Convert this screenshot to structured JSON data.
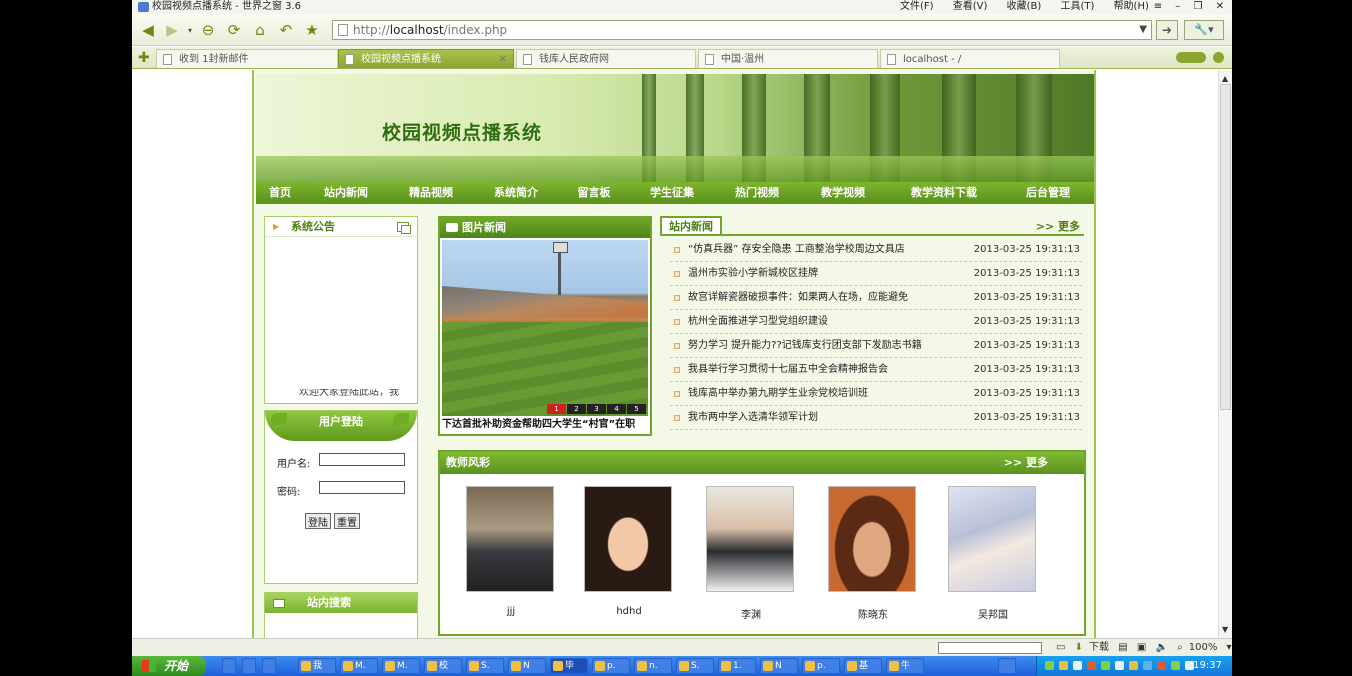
{
  "browser": {
    "title": "校园视频点播系统 - 世界之窗 3.6",
    "menu": [
      "文件(F)",
      "查看(V)",
      "收藏(B)",
      "工具(T)",
      "帮助(H)"
    ],
    "address_prefix": "http://",
    "address_host": "localhost",
    "address_path": "/index.php",
    "tabs": [
      {
        "label": "收到 1封新邮件",
        "active": false
      },
      {
        "label": "校园视频点播系统",
        "active": true
      },
      {
        "label": "钱库人民政府网",
        "active": false
      },
      {
        "label": "中国·温州",
        "active": false
      },
      {
        "label": "localhost - /",
        "active": false
      }
    ]
  },
  "site": {
    "banner_title": "校园视频点播系统",
    "nav": [
      "首页",
      "站内新闻",
      "精品视频",
      "系统简介",
      "留言板",
      "学生征集",
      "热门视频",
      "教学视频",
      "教学资料下载",
      "后台管理"
    ],
    "notice": {
      "title": "系统公告",
      "marquee": "欢迎大家登陆此站，我"
    },
    "login": {
      "title": "用户登陆",
      "username_label": "用户名:",
      "password_label": "密码:",
      "login_button": "登陆",
      "reset_button": "重置"
    },
    "search": {
      "title": "站内搜索"
    },
    "photo_news": {
      "title": "图片新闻",
      "pages": [
        "1",
        "2",
        "3",
        "4",
        "5"
      ],
      "active_page": "1",
      "caption": "下达首批补助资金帮助四大学生“村官”在职"
    },
    "news": {
      "title": "站内新闻",
      "more": ">> 更多",
      "items": [
        {
          "title": "“仿真兵器” 存安全隐患 工商整治学校周边文具店",
          "date": "2013-03-25 19:31:13"
        },
        {
          "title": "温州市实验小学新城校区挂牌",
          "date": "2013-03-25 19:31:13"
        },
        {
          "title": "故宫详解瓷器破损事件：如果两人在场，应能避免",
          "date": "2013-03-25 19:31:13"
        },
        {
          "title": "杭州全面推进学习型党组织建设",
          "date": "2013-03-25 19:31:13"
        },
        {
          "title": "努力学习 提升能力??记钱库支行团支部下发励志书籍",
          "date": "2013-03-25 19:31:13"
        },
        {
          "title": "我县举行学习贯彻十七届五中全会精神报告会",
          "date": "2013-03-25 19:31:13"
        },
        {
          "title": "钱库高中举办第九期学生业余党校培训班",
          "date": "2013-03-25 19:31:13"
        },
        {
          "title": "我市两中学入选清华领军计划",
          "date": "2013-03-25 19:31:13"
        }
      ]
    },
    "teachers": {
      "title": "教师风彩",
      "more": ">> 更多",
      "items": [
        {
          "name": "jjj"
        },
        {
          "name": "hdhd"
        },
        {
          "name": "李渊"
        },
        {
          "name": "陈晓东"
        },
        {
          "name": "吴邦国"
        }
      ]
    }
  },
  "statusbar": {
    "download": "下载",
    "zoom": "100%"
  },
  "taskbar": {
    "start": "开始",
    "items": [
      "我",
      "M.",
      "M.",
      "校",
      "S.",
      "N",
      "毕",
      "p.",
      "n.",
      "S.",
      "1.",
      "N",
      "p.",
      "基",
      "牛"
    ],
    "clock": "19:37"
  },
  "colors": {
    "nav_green": "#58901a",
    "panel_border": "#a9cf6a",
    "title_green": "#2f6e10",
    "pager_active": "#d02020"
  }
}
